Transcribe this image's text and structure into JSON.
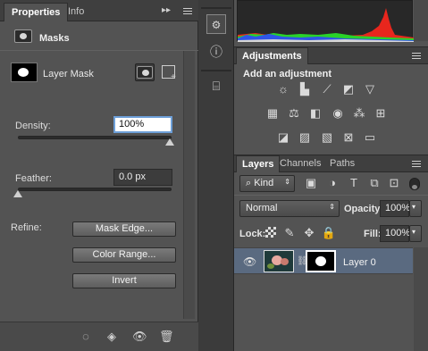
{
  "properties": {
    "tabs": [
      "Properties",
      "Info"
    ],
    "section_title": "Masks",
    "mask_type": "Layer Mask",
    "density": {
      "label": "Density:",
      "value": "100%",
      "level": 1.0
    },
    "feather": {
      "label": "Feather:",
      "value": "0.0 px",
      "level": 0.0
    },
    "refine_label": "Refine:",
    "buttons": [
      "Mask Edge...",
      "Color Range...",
      "Invert"
    ]
  },
  "adjustments": {
    "tab": "Adjustments",
    "heading": "Add an adjustment"
  },
  "layers": {
    "tabs": [
      "Layers",
      "Channels",
      "Paths"
    ],
    "filter_kind": "Kind",
    "blend_mode": "Normal",
    "opacity_label": "Opacity:",
    "opacity_value": "100%",
    "lock_label": "Lock:",
    "fill_label": "Fill:",
    "fill_value": "100%",
    "layer_name": "Layer 0"
  },
  "colors": {
    "panel": "#535353",
    "selected_layer": "#5a6a80",
    "histogram_red": "#e8261d",
    "histogram_green": "#29d32a",
    "histogram_blue": "#2f55e8"
  }
}
